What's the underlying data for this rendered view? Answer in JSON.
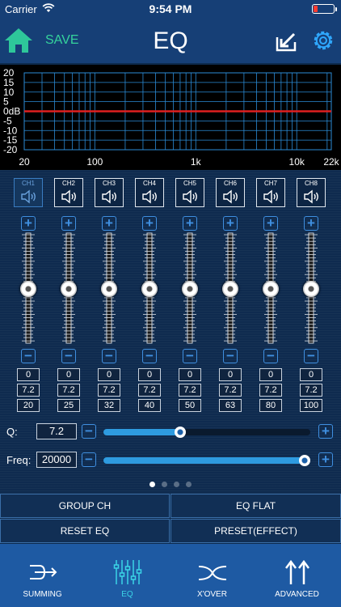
{
  "status": {
    "carrier": "Carrier",
    "time": "9:54 PM"
  },
  "header": {
    "save_label": "SAVE",
    "title": "EQ"
  },
  "graph": {
    "y_labels": [
      "20",
      "15",
      "10",
      "5",
      "0dB",
      "-5",
      "-10",
      "-15",
      "-20"
    ],
    "x_labels": [
      "20",
      "100",
      "1k",
      "10k",
      "22k"
    ]
  },
  "channels": [
    {
      "label": "CH1",
      "gain": "0",
      "q": "7.2",
      "freq": "20"
    },
    {
      "label": "CH2",
      "gain": "0",
      "q": "7.2",
      "freq": "25"
    },
    {
      "label": "CH3",
      "gain": "0",
      "q": "7.2",
      "freq": "32"
    },
    {
      "label": "CH4",
      "gain": "0",
      "q": "7.2",
      "freq": "40"
    },
    {
      "label": "CH5",
      "gain": "0",
      "q": "7.2",
      "freq": "50"
    },
    {
      "label": "CH6",
      "gain": "0",
      "q": "7.2",
      "freq": "63"
    },
    {
      "label": "CH7",
      "gain": "0",
      "q": "7.2",
      "freq": "80"
    },
    {
      "label": "CH8",
      "gain": "0",
      "q": "7.2",
      "freq": "100"
    }
  ],
  "q_row": {
    "label": "Q:",
    "value": "7.2",
    "level": 0.37
  },
  "freq_row": {
    "label": "Freq:",
    "value": "20000",
    "level": 1.0
  },
  "actions": {
    "group_ch": "GROUP CH",
    "eq_flat": "EQ FLAT",
    "reset_eq": "RESET EQ",
    "preset": "PRESET(EFFECT)"
  },
  "tabs": [
    {
      "label": "SUMMING"
    },
    {
      "label": "EQ"
    },
    {
      "label": "X'OVER"
    },
    {
      "label": "ADVANCED"
    }
  ],
  "colors": {
    "accent": "#2e9be0",
    "save": "#35d39c",
    "curve": "#e02020",
    "tab_active": "#3ad4e6"
  }
}
